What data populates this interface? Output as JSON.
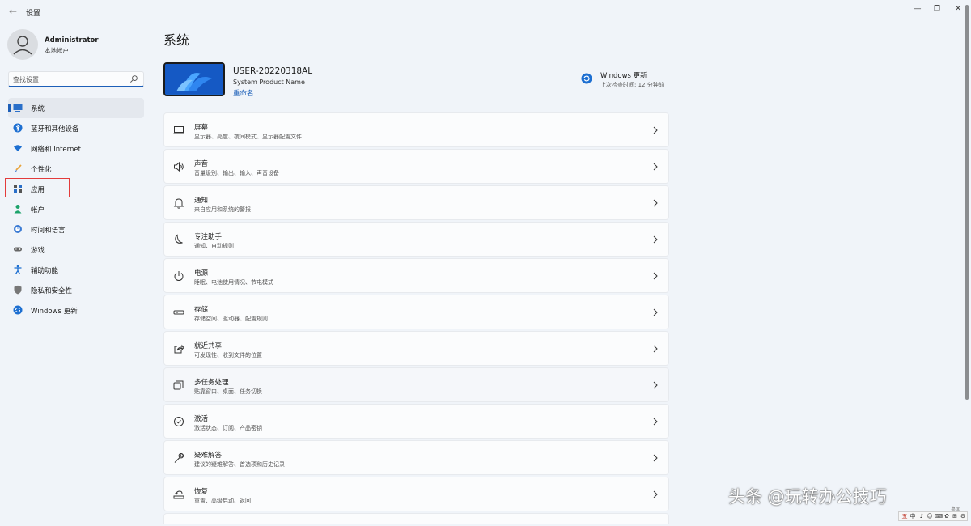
{
  "window": {
    "title": "设置",
    "back_glyph": "←",
    "min_glyph": "—",
    "max_glyph": "❐",
    "close_glyph": "✕"
  },
  "profile": {
    "name": "Administrator",
    "subtitle": "本地帐户"
  },
  "search": {
    "placeholder": "查找设置"
  },
  "sidebar": {
    "items": [
      {
        "label": "系统",
        "icon": "monitor-icon",
        "active": true
      },
      {
        "label": "蓝牙和其他设备",
        "icon": "bluetooth-icon"
      },
      {
        "label": "网络和 Internet",
        "icon": "wifi-icon"
      },
      {
        "label": "个性化",
        "icon": "brush-icon"
      },
      {
        "label": "应用",
        "icon": "apps-icon"
      },
      {
        "label": "帐户",
        "icon": "person-icon"
      },
      {
        "label": "时间和语言",
        "icon": "globe-clock-icon"
      },
      {
        "label": "游戏",
        "icon": "gamepad-icon"
      },
      {
        "label": "辅助功能",
        "icon": "accessibility-icon"
      },
      {
        "label": "隐私和安全性",
        "icon": "shield-icon"
      },
      {
        "label": "Windows 更新",
        "icon": "update-icon"
      }
    ]
  },
  "main": {
    "title": "系统",
    "device": {
      "name": "USER-20220318AL",
      "model": "System Product Name",
      "rename": "重命名"
    },
    "update": {
      "title": "Windows 更新",
      "subtitle": "上次检查时间: 12 分钟前"
    },
    "cards": [
      {
        "title": "屏幕",
        "subtitle": "显示器、亮度、夜间模式、显示器配置文件",
        "icon": "display-icon"
      },
      {
        "title": "声音",
        "subtitle": "音量级别、输出、输入、声音设备",
        "icon": "speaker-icon"
      },
      {
        "title": "通知",
        "subtitle": "来自应用和系统的警报",
        "icon": "bell-icon"
      },
      {
        "title": "专注助手",
        "subtitle": "通知、自动规则",
        "icon": "moon-icon"
      },
      {
        "title": "电源",
        "subtitle": "睡眠、电池使用情况、节电模式",
        "icon": "power-icon"
      },
      {
        "title": "存储",
        "subtitle": "存储空间、驱动器、配置规则",
        "icon": "storage-icon"
      },
      {
        "title": "就近共享",
        "subtitle": "可发现性、收到文件的位置",
        "icon": "share-icon"
      },
      {
        "title": "多任务处理",
        "subtitle": "贴靠窗口、桌面、任务切换",
        "icon": "multitask-icon"
      },
      {
        "title": "激活",
        "subtitle": "激活状态、订阅、产品密钥",
        "icon": "check-circle-icon"
      },
      {
        "title": "疑难解答",
        "subtitle": "建议的疑难解答、首选项和历史记录",
        "icon": "wrench-icon"
      },
      {
        "title": "恢复",
        "subtitle": "重置、高级启动、返回",
        "icon": "recovery-icon"
      }
    ],
    "chevron_glyph": "›"
  },
  "overlay": {
    "watermark": "头条 @玩转办公技巧",
    "tray_caption": "桌面",
    "tray": [
      "五",
      "中",
      "♪",
      "☺",
      "⌨",
      "✿",
      "⊞",
      "⚙"
    ]
  },
  "colors": {
    "accent": "#1d5fb8",
    "highlight": "#e33b3b",
    "background": "#f0f4f9",
    "card": "#fbfcfd"
  }
}
